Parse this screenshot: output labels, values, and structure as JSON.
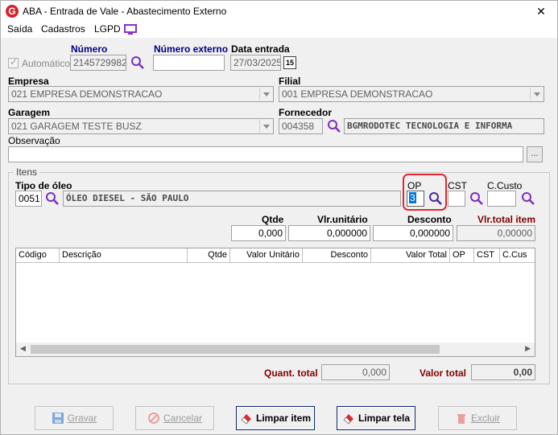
{
  "window": {
    "title": "ABA - Entrada de Vale - Abastecimento Externo",
    "close_glyph": "✕",
    "app_icon_letter": "G"
  },
  "menu": {
    "items": [
      "Saída",
      "Cadastros",
      "LGPD"
    ]
  },
  "header": {
    "automatico_label": "Automático",
    "numero_label": "Número",
    "numero_value": "2145729982",
    "numero_externo_label": "Número externo",
    "numero_externo_value": "",
    "data_entrada_label": "Data entrada",
    "data_entrada_value": "27/03/2025",
    "calendar_glyph": "15"
  },
  "empresa": {
    "label": "Empresa",
    "value": "021 EMPRESA DEMONSTRACAO"
  },
  "filial": {
    "label": "Filial",
    "value": "001 EMPRESA DEMONSTRACAO"
  },
  "garagem": {
    "label": "Garagem",
    "value": "021 GARAGEM TESTE BUSZ"
  },
  "fornecedor": {
    "label": "Fornecedor",
    "code": "004358",
    "name": "BGMRODOTEC TECNOLOGIA E INFORMA"
  },
  "observacao": {
    "label": "Observação",
    "value": "",
    "dots": "..."
  },
  "itens": {
    "group_title": "Itens",
    "tipo_oleo_label": "Tipo de óleo",
    "tipo_oleo_code": "0051",
    "tipo_oleo_name": "ÓLEO DIESEL - SÃO PAULO",
    "op_label": "OP",
    "op_value": "3",
    "cst_label": "CST",
    "cst_value": "",
    "ccusto_label": "C.Custo",
    "ccusto_value": "",
    "qtde_label": "Qtde",
    "qtde_value": "0,000",
    "vlr_unitario_label": "Vlr.unitário",
    "vlr_unitario_value": "0,000000",
    "desconto_label": "Desconto",
    "desconto_value": "0,000000",
    "vlr_total_item_label": "Vlr.total item",
    "vlr_total_item_value": "0,00000"
  },
  "grid": {
    "columns": [
      "Código",
      "Descrição",
      "Qtde",
      "Valor Unitário",
      "Desconto",
      "Valor Total",
      "OP",
      "CST",
      "C.Cus"
    ],
    "rows": []
  },
  "totals": {
    "quant_total_label": "Quant. total",
    "quant_total_value": "0,000",
    "valor_total_label": "Valor total",
    "valor_total_value": "0,00"
  },
  "buttons": {
    "gravar": "Gravar",
    "cancelar": "Cancelar",
    "limpar_item": "Limpar item",
    "limpar_tela": "Limpar tela",
    "excluir": "Excluir"
  },
  "colors": {
    "accent_red": "#e0282e",
    "navy_label": "#000080",
    "maroon_label": "#800000",
    "search_purple": "#7b2fbe"
  }
}
